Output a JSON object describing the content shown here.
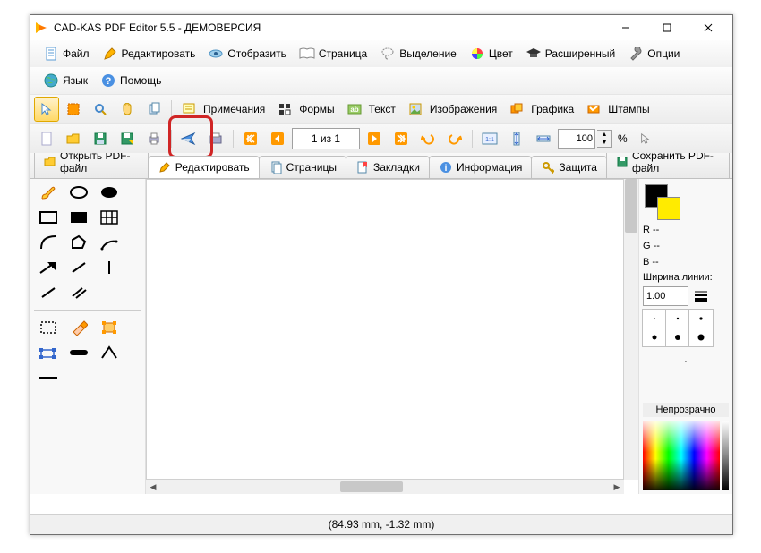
{
  "window": {
    "title": "CAD-KAS PDF Editor 5.5 - ДЕМОВЕРСИЯ"
  },
  "menu": {
    "file": "Файл",
    "edit": "Редактировать",
    "view": "Отобразить",
    "page": "Страница",
    "selection": "Выделение",
    "color": "Цвет",
    "advanced": "Расширенный",
    "options": "Опции",
    "language": "Язык",
    "help": "Помощь"
  },
  "toolbar": {
    "notes": "Примечания",
    "forms": "Формы",
    "text": "Текст",
    "images": "Изображения",
    "graphics": "Графика",
    "stamps": "Штампы",
    "page_of": "1 из 1",
    "zoom_value": "100",
    "percent": "%"
  },
  "tabs": {
    "open": "Открыть PDF-файл",
    "edit": "Редактировать",
    "pages": "Страницы",
    "bookmarks": "Закладки",
    "info": "Информация",
    "protect": "Защита",
    "save": "Сохранить PDF-файл"
  },
  "panel": {
    "r": "R --",
    "g": "G --",
    "b": "B --",
    "linewidth_label": "Ширина линии:",
    "linewidth_value": "1.00",
    "opacity": "Непрозрачно"
  },
  "status": {
    "coords": "(84.93 mm, -1.32 mm)"
  }
}
